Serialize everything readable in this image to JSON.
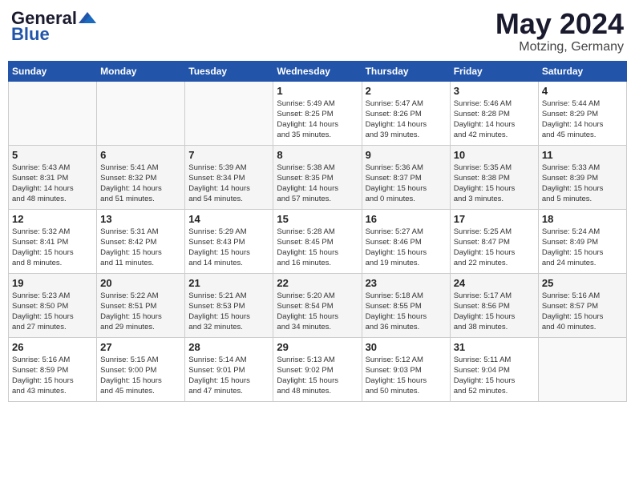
{
  "header": {
    "logo_general": "General",
    "logo_blue": "Blue",
    "month_title": "May 2024",
    "location": "Motzing, Germany"
  },
  "days_of_week": [
    "Sunday",
    "Monday",
    "Tuesday",
    "Wednesday",
    "Thursday",
    "Friday",
    "Saturday"
  ],
  "weeks": [
    [
      {
        "day": "",
        "info": ""
      },
      {
        "day": "",
        "info": ""
      },
      {
        "day": "",
        "info": ""
      },
      {
        "day": "1",
        "info": "Sunrise: 5:49 AM\nSunset: 8:25 PM\nDaylight: 14 hours\nand 35 minutes."
      },
      {
        "day": "2",
        "info": "Sunrise: 5:47 AM\nSunset: 8:26 PM\nDaylight: 14 hours\nand 39 minutes."
      },
      {
        "day": "3",
        "info": "Sunrise: 5:46 AM\nSunset: 8:28 PM\nDaylight: 14 hours\nand 42 minutes."
      },
      {
        "day": "4",
        "info": "Sunrise: 5:44 AM\nSunset: 8:29 PM\nDaylight: 14 hours\nand 45 minutes."
      }
    ],
    [
      {
        "day": "5",
        "info": "Sunrise: 5:43 AM\nSunset: 8:31 PM\nDaylight: 14 hours\nand 48 minutes."
      },
      {
        "day": "6",
        "info": "Sunrise: 5:41 AM\nSunset: 8:32 PM\nDaylight: 14 hours\nand 51 minutes."
      },
      {
        "day": "7",
        "info": "Sunrise: 5:39 AM\nSunset: 8:34 PM\nDaylight: 14 hours\nand 54 minutes."
      },
      {
        "day": "8",
        "info": "Sunrise: 5:38 AM\nSunset: 8:35 PM\nDaylight: 14 hours\nand 57 minutes."
      },
      {
        "day": "9",
        "info": "Sunrise: 5:36 AM\nSunset: 8:37 PM\nDaylight: 15 hours\nand 0 minutes."
      },
      {
        "day": "10",
        "info": "Sunrise: 5:35 AM\nSunset: 8:38 PM\nDaylight: 15 hours\nand 3 minutes."
      },
      {
        "day": "11",
        "info": "Sunrise: 5:33 AM\nSunset: 8:39 PM\nDaylight: 15 hours\nand 5 minutes."
      }
    ],
    [
      {
        "day": "12",
        "info": "Sunrise: 5:32 AM\nSunset: 8:41 PM\nDaylight: 15 hours\nand 8 minutes."
      },
      {
        "day": "13",
        "info": "Sunrise: 5:31 AM\nSunset: 8:42 PM\nDaylight: 15 hours\nand 11 minutes."
      },
      {
        "day": "14",
        "info": "Sunrise: 5:29 AM\nSunset: 8:43 PM\nDaylight: 15 hours\nand 14 minutes."
      },
      {
        "day": "15",
        "info": "Sunrise: 5:28 AM\nSunset: 8:45 PM\nDaylight: 15 hours\nand 16 minutes."
      },
      {
        "day": "16",
        "info": "Sunrise: 5:27 AM\nSunset: 8:46 PM\nDaylight: 15 hours\nand 19 minutes."
      },
      {
        "day": "17",
        "info": "Sunrise: 5:25 AM\nSunset: 8:47 PM\nDaylight: 15 hours\nand 22 minutes."
      },
      {
        "day": "18",
        "info": "Sunrise: 5:24 AM\nSunset: 8:49 PM\nDaylight: 15 hours\nand 24 minutes."
      }
    ],
    [
      {
        "day": "19",
        "info": "Sunrise: 5:23 AM\nSunset: 8:50 PM\nDaylight: 15 hours\nand 27 minutes."
      },
      {
        "day": "20",
        "info": "Sunrise: 5:22 AM\nSunset: 8:51 PM\nDaylight: 15 hours\nand 29 minutes."
      },
      {
        "day": "21",
        "info": "Sunrise: 5:21 AM\nSunset: 8:53 PM\nDaylight: 15 hours\nand 32 minutes."
      },
      {
        "day": "22",
        "info": "Sunrise: 5:20 AM\nSunset: 8:54 PM\nDaylight: 15 hours\nand 34 minutes."
      },
      {
        "day": "23",
        "info": "Sunrise: 5:18 AM\nSunset: 8:55 PM\nDaylight: 15 hours\nand 36 minutes."
      },
      {
        "day": "24",
        "info": "Sunrise: 5:17 AM\nSunset: 8:56 PM\nDaylight: 15 hours\nand 38 minutes."
      },
      {
        "day": "25",
        "info": "Sunrise: 5:16 AM\nSunset: 8:57 PM\nDaylight: 15 hours\nand 40 minutes."
      }
    ],
    [
      {
        "day": "26",
        "info": "Sunrise: 5:16 AM\nSunset: 8:59 PM\nDaylight: 15 hours\nand 43 minutes."
      },
      {
        "day": "27",
        "info": "Sunrise: 5:15 AM\nSunset: 9:00 PM\nDaylight: 15 hours\nand 45 minutes."
      },
      {
        "day": "28",
        "info": "Sunrise: 5:14 AM\nSunset: 9:01 PM\nDaylight: 15 hours\nand 47 minutes."
      },
      {
        "day": "29",
        "info": "Sunrise: 5:13 AM\nSunset: 9:02 PM\nDaylight: 15 hours\nand 48 minutes."
      },
      {
        "day": "30",
        "info": "Sunrise: 5:12 AM\nSunset: 9:03 PM\nDaylight: 15 hours\nand 50 minutes."
      },
      {
        "day": "31",
        "info": "Sunrise: 5:11 AM\nSunset: 9:04 PM\nDaylight: 15 hours\nand 52 minutes."
      },
      {
        "day": "",
        "info": ""
      }
    ]
  ]
}
